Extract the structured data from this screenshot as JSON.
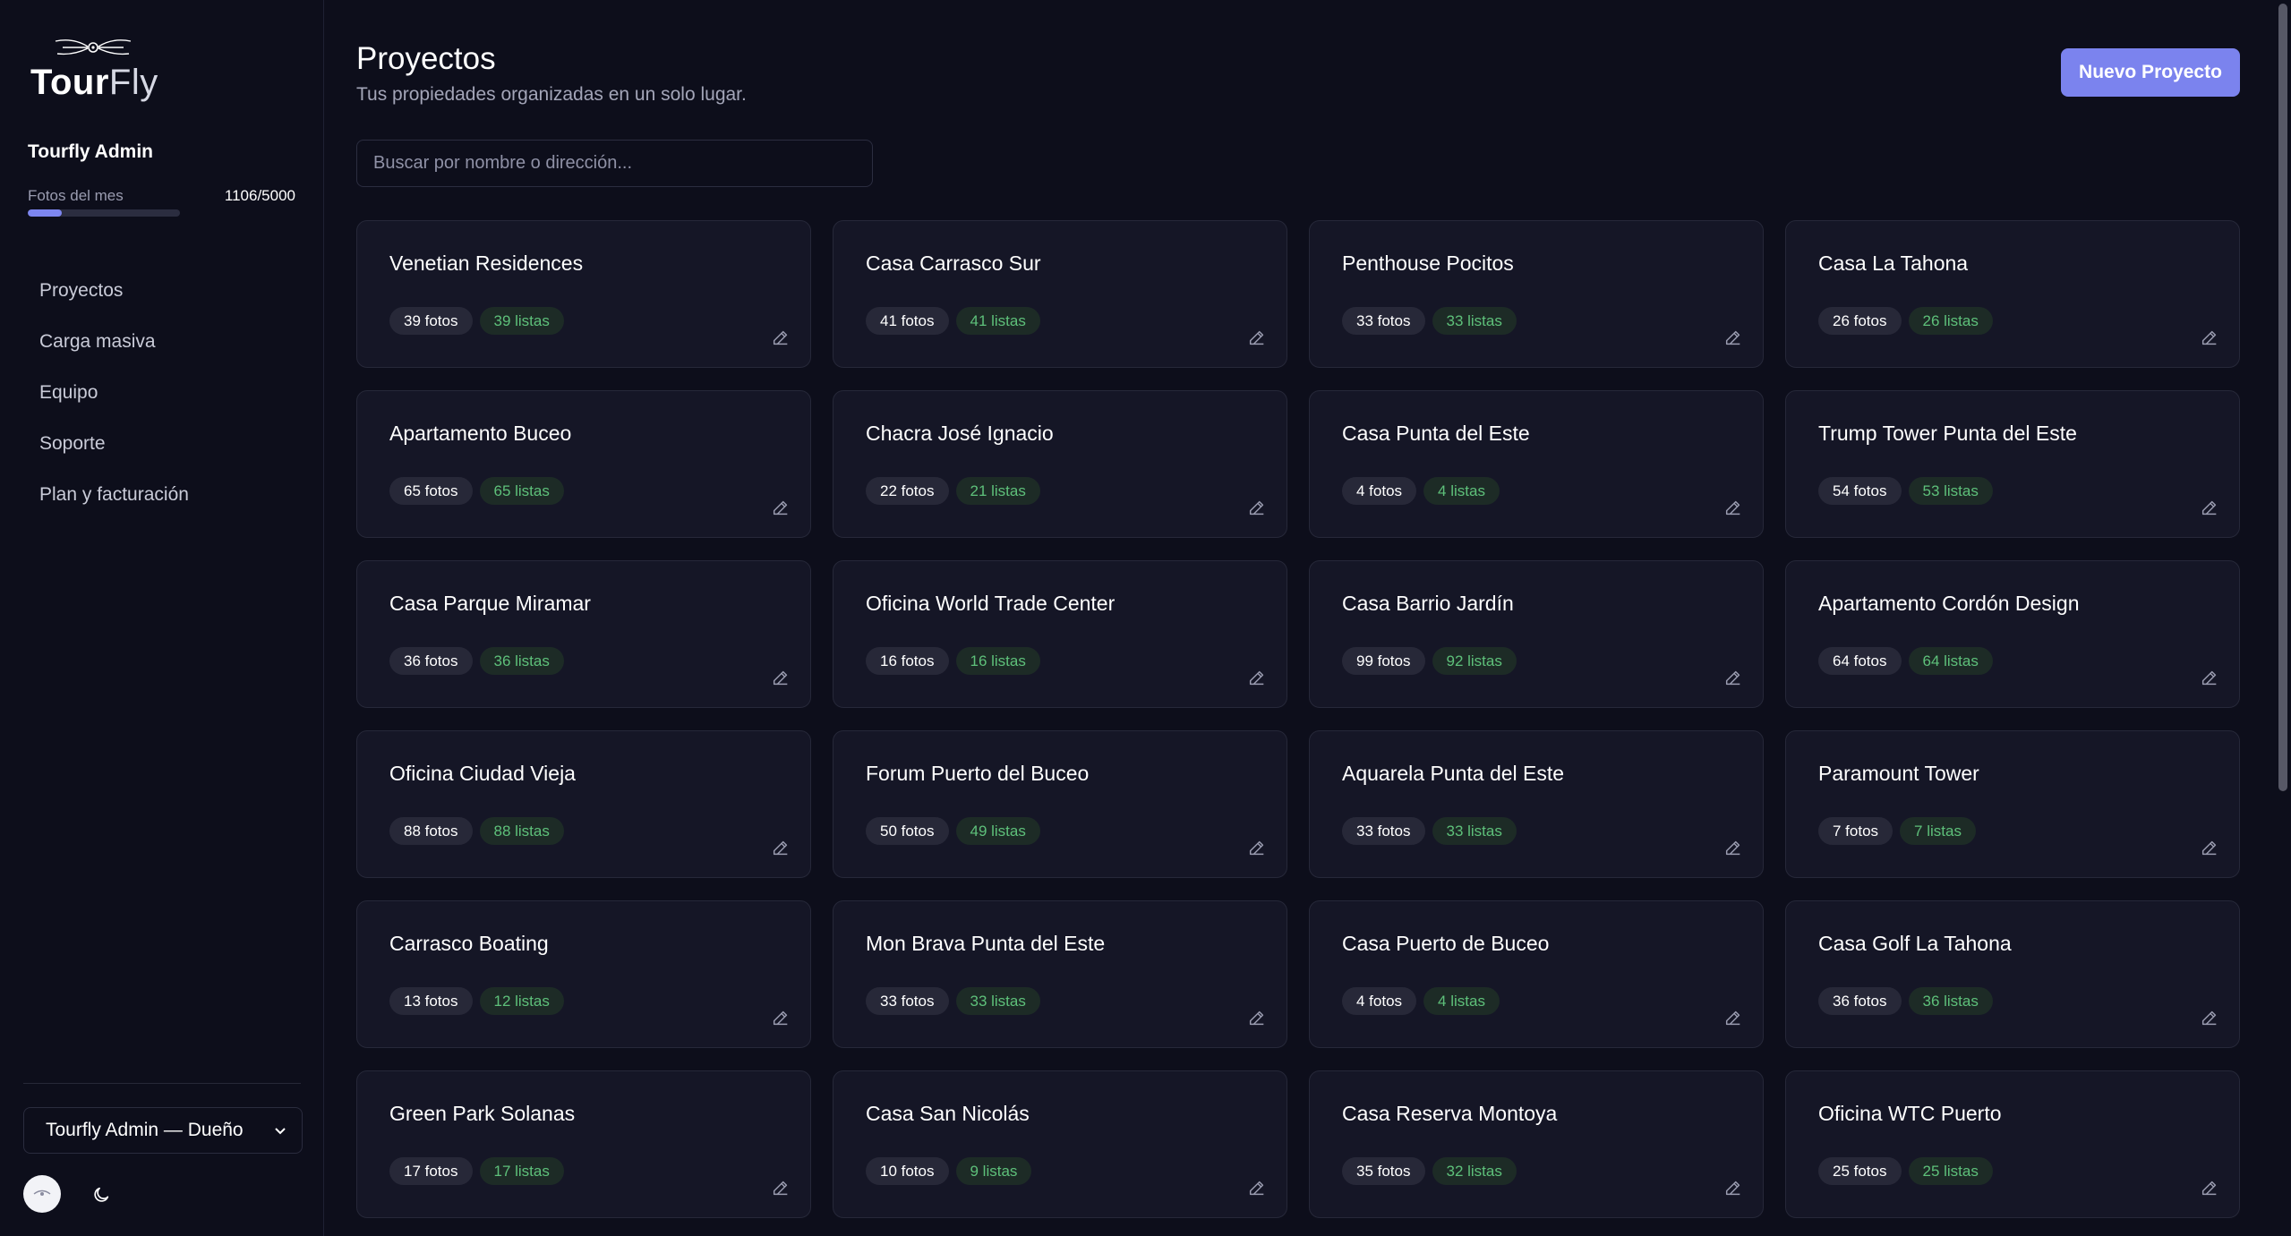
{
  "brand": {
    "bold": "Tour",
    "light": "Fly"
  },
  "sidebar": {
    "user_name": "Tourfly Admin",
    "quota_label": "Fotos del mes",
    "quota_value": "1106/5000",
    "quota_fraction": 0.2212,
    "nav": [
      {
        "label": "Proyectos"
      },
      {
        "label": "Carga masiva"
      },
      {
        "label": "Equipo"
      },
      {
        "label": "Soporte"
      },
      {
        "label": "Plan y facturación"
      }
    ],
    "role_select": "Tourfly Admin — Dueño",
    "theme_icon": "moon-icon"
  },
  "header": {
    "title": "Proyectos",
    "subtitle": "Tus propiedades organizadas en un solo lugar.",
    "new_button": "Nuevo Proyecto"
  },
  "search": {
    "placeholder": "Buscar por nombre o dirección..."
  },
  "colors": {
    "accent": "#7b83ee",
    "lists_green": "#5ec07a",
    "background": "#0d0e1b",
    "card": "#151626"
  },
  "projects": [
    {
      "name": "Venetian Residences",
      "photos": "39 fotos",
      "lists": "39 listas"
    },
    {
      "name": "Casa Carrasco Sur",
      "photos": "41 fotos",
      "lists": "41 listas"
    },
    {
      "name": "Penthouse Pocitos",
      "photos": "33 fotos",
      "lists": "33 listas"
    },
    {
      "name": "Casa La Tahona",
      "photos": "26 fotos",
      "lists": "26 listas"
    },
    {
      "name": "Apartamento Buceo",
      "photos": "65 fotos",
      "lists": "65 listas"
    },
    {
      "name": "Chacra José Ignacio",
      "photos": "22 fotos",
      "lists": "21 listas"
    },
    {
      "name": "Casa Punta del Este",
      "photos": "4 fotos",
      "lists": "4 listas"
    },
    {
      "name": "Trump Tower Punta del Este",
      "photos": "54 fotos",
      "lists": "53 listas"
    },
    {
      "name": "Casa Parque Miramar",
      "photos": "36 fotos",
      "lists": "36 listas"
    },
    {
      "name": "Oficina World Trade Center",
      "photos": "16 fotos",
      "lists": "16 listas"
    },
    {
      "name": "Casa Barrio Jardín",
      "photos": "99 fotos",
      "lists": "92 listas"
    },
    {
      "name": "Apartamento Cordón Design",
      "photos": "64 fotos",
      "lists": "64 listas"
    },
    {
      "name": "Oficina Ciudad Vieja",
      "photos": "88 fotos",
      "lists": "88 listas"
    },
    {
      "name": "Forum Puerto del Buceo",
      "photos": "50 fotos",
      "lists": "49 listas"
    },
    {
      "name": "Aquarela Punta del Este",
      "photos": "33 fotos",
      "lists": "33 listas"
    },
    {
      "name": "Paramount Tower",
      "photos": "7 fotos",
      "lists": "7 listas"
    },
    {
      "name": "Carrasco Boating",
      "photos": "13 fotos",
      "lists": "12 listas"
    },
    {
      "name": "Mon Brava Punta del Este",
      "photos": "33 fotos",
      "lists": "33 listas"
    },
    {
      "name": "Casa Puerto de Buceo",
      "photos": "4 fotos",
      "lists": "4 listas"
    },
    {
      "name": "Casa Golf La Tahona",
      "photos": "36 fotos",
      "lists": "36 listas"
    },
    {
      "name": "Green Park Solanas",
      "photos": "17 fotos",
      "lists": "17 listas"
    },
    {
      "name": "Casa San Nicolás",
      "photos": "10 fotos",
      "lists": "9 listas"
    },
    {
      "name": "Casa Reserva Montoya",
      "photos": "35 fotos",
      "lists": "32 listas"
    },
    {
      "name": "Oficina WTC Puerto",
      "photos": "25 fotos",
      "lists": "25 listas"
    }
  ]
}
